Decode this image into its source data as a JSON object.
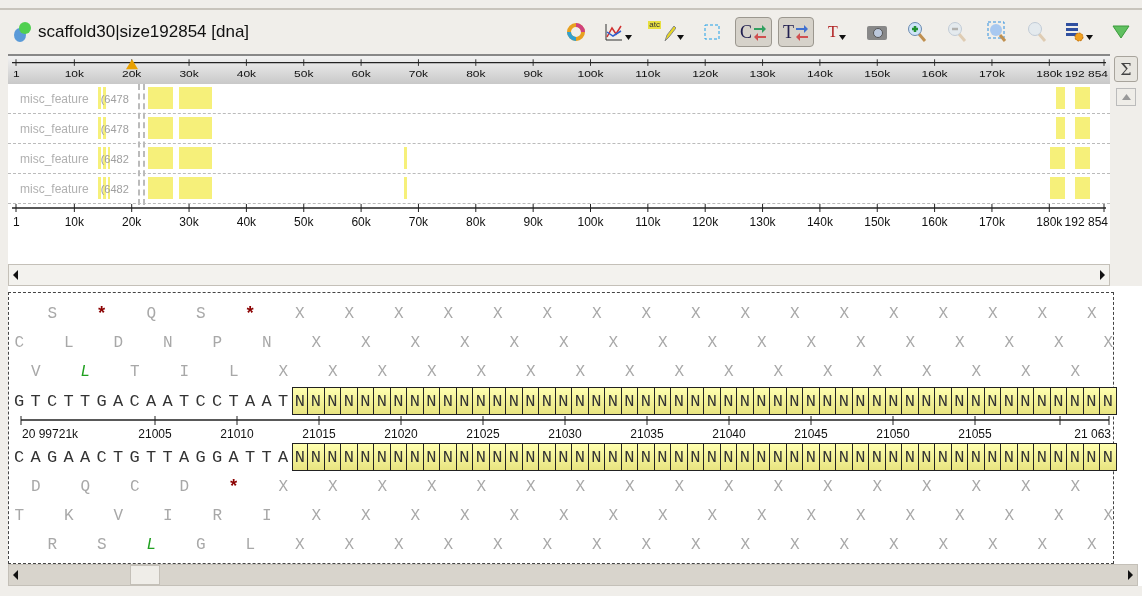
{
  "window": {
    "title": "scaffold30|size192854 [dna]"
  },
  "toolbar": [
    {
      "kind": "ring",
      "pressed": false,
      "disabled": false,
      "dropdown": false
    },
    {
      "kind": "graph",
      "pressed": false,
      "disabled": false,
      "dropdown": true
    },
    {
      "kind": "highlight",
      "glyph": "atc",
      "pressed": false,
      "disabled": false,
      "dropdown": true
    },
    {
      "kind": "select",
      "pressed": false,
      "disabled": false,
      "dropdown": false
    },
    {
      "kind": "complement",
      "glyph": "C",
      "pressed": true,
      "disabled": false,
      "dropdown": false
    },
    {
      "kind": "translate",
      "glyph": "T",
      "pressed": true,
      "disabled": false,
      "dropdown": false
    },
    {
      "kind": "font",
      "glyph": "T",
      "pressed": false,
      "disabled": false,
      "dropdown": true
    },
    {
      "kind": "camera",
      "pressed": false,
      "disabled": false,
      "dropdown": false
    },
    {
      "kind": "zoomin",
      "pressed": false,
      "disabled": false,
      "dropdown": false
    },
    {
      "kind": "zoomout",
      "pressed": false,
      "disabled": true,
      "dropdown": false
    },
    {
      "kind": "zoomselection",
      "pressed": false,
      "disabled": false,
      "dropdown": false
    },
    {
      "kind": "zoomall",
      "pressed": false,
      "disabled": true,
      "dropdown": false
    },
    {
      "kind": "settings",
      "pressed": false,
      "disabled": false,
      "dropdown": true
    },
    {
      "kind": "menu",
      "pressed": false,
      "disabled": false,
      "dropdown": false
    }
  ],
  "overview": {
    "ruler_labels": [
      "1",
      "10k",
      "20k",
      "30k",
      "40k",
      "50k",
      "60k",
      "70k",
      "80k",
      "90k",
      "100k",
      "110k",
      "120k",
      "130k",
      "140k",
      "150k",
      "160k",
      "170k",
      "180k",
      "192 854"
    ],
    "bottom_ruler_labels": [
      "1",
      "10k",
      "20k",
      "30k",
      "40k",
      "50k",
      "60k",
      "70k",
      "80k",
      "90k",
      "100k",
      "110k",
      "120k",
      "130k",
      "140k",
      "150k",
      "160k",
      "170k",
      "180k",
      "192 854"
    ],
    "tracks": [
      {
        "name": "misc_feature",
        "count": "(6478"
      },
      {
        "name": "misc_feature",
        "count": "(6478"
      },
      {
        "name": "misc_feature",
        "count": "(6482"
      },
      {
        "name": "misc_feature",
        "count": "(6482"
      }
    ],
    "sum_button": "Σ"
  },
  "detail": {
    "top_frames": [
      {
        "residues": [
          {
            "aa": "S",
            "kind": "plain"
          },
          {
            "aa": "*",
            "kind": "stop"
          },
          {
            "aa": "Q",
            "kind": "plain"
          },
          {
            "aa": "S",
            "kind": "plain"
          },
          {
            "aa": "*",
            "kind": "stop"
          },
          {
            "aa": "X",
            "kind": "plain"
          },
          {
            "aa": "X",
            "kind": "plain"
          },
          {
            "aa": "X",
            "kind": "plain"
          },
          {
            "aa": "X",
            "kind": "plain"
          },
          {
            "aa": "X",
            "kind": "plain"
          },
          {
            "aa": "X",
            "kind": "plain"
          },
          {
            "aa": "X",
            "kind": "plain"
          },
          {
            "aa": "X",
            "kind": "plain"
          },
          {
            "aa": "X",
            "kind": "plain"
          },
          {
            "aa": "X",
            "kind": "plain"
          },
          {
            "aa": "X",
            "kind": "plain"
          },
          {
            "aa": "X",
            "kind": "plain"
          },
          {
            "aa": "X",
            "kind": "plain"
          },
          {
            "aa": "X",
            "kind": "plain"
          },
          {
            "aa": "X",
            "kind": "plain"
          },
          {
            "aa": "X",
            "kind": "plain"
          },
          {
            "aa": "X",
            "kind": "plain"
          }
        ]
      },
      {
        "residues": [
          {
            "aa": "C",
            "kind": "plain"
          },
          {
            "aa": "L",
            "kind": "plain"
          },
          {
            "aa": "D",
            "kind": "plain"
          },
          {
            "aa": "N",
            "kind": "plain"
          },
          {
            "aa": "P",
            "kind": "plain"
          },
          {
            "aa": "N",
            "kind": "plain"
          },
          {
            "aa": "X",
            "kind": "plain"
          },
          {
            "aa": "X",
            "kind": "plain"
          },
          {
            "aa": "X",
            "kind": "plain"
          },
          {
            "aa": "X",
            "kind": "plain"
          },
          {
            "aa": "X",
            "kind": "plain"
          },
          {
            "aa": "X",
            "kind": "plain"
          },
          {
            "aa": "X",
            "kind": "plain"
          },
          {
            "aa": "X",
            "kind": "plain"
          },
          {
            "aa": "X",
            "kind": "plain"
          },
          {
            "aa": "X",
            "kind": "plain"
          },
          {
            "aa": "X",
            "kind": "plain"
          },
          {
            "aa": "X",
            "kind": "plain"
          },
          {
            "aa": "X",
            "kind": "plain"
          },
          {
            "aa": "X",
            "kind": "plain"
          },
          {
            "aa": "X",
            "kind": "plain"
          },
          {
            "aa": "X",
            "kind": "plain"
          },
          {
            "aa": "X",
            "kind": "plain"
          }
        ]
      },
      {
        "residues": [
          {
            "aa": "V",
            "kind": "plain"
          },
          {
            "aa": "L",
            "kind": "start"
          },
          {
            "aa": "T",
            "kind": "plain"
          },
          {
            "aa": "I",
            "kind": "plain"
          },
          {
            "aa": "L",
            "kind": "plain"
          },
          {
            "aa": "X",
            "kind": "plain"
          },
          {
            "aa": "X",
            "kind": "plain"
          },
          {
            "aa": "X",
            "kind": "plain"
          },
          {
            "aa": "X",
            "kind": "plain"
          },
          {
            "aa": "X",
            "kind": "plain"
          },
          {
            "aa": "X",
            "kind": "plain"
          },
          {
            "aa": "X",
            "kind": "plain"
          },
          {
            "aa": "X",
            "kind": "plain"
          },
          {
            "aa": "X",
            "kind": "plain"
          },
          {
            "aa": "X",
            "kind": "plain"
          },
          {
            "aa": "X",
            "kind": "plain"
          },
          {
            "aa": "X",
            "kind": "plain"
          },
          {
            "aa": "X",
            "kind": "plain"
          },
          {
            "aa": "X",
            "kind": "plain"
          },
          {
            "aa": "X",
            "kind": "plain"
          },
          {
            "aa": "X",
            "kind": "plain"
          },
          {
            "aa": "X",
            "kind": "plain"
          }
        ]
      }
    ],
    "top_strand": {
      "bases": "GTCTTGACAATCCTAAT",
      "masked": [
        "N",
        "N",
        "N",
        "N",
        "N",
        "N",
        "N",
        "N",
        "N",
        "N",
        "N",
        "N",
        "N",
        "N",
        "N",
        "N",
        "N",
        "N",
        "N",
        "N",
        "N",
        "N",
        "N",
        "N",
        "N",
        "N",
        "N",
        "N",
        "N",
        "N",
        "N",
        "N",
        "N",
        "N",
        "N",
        "N",
        "N",
        "N",
        "N",
        "N",
        "N",
        "N",
        "N",
        "N",
        "N",
        "N",
        "N",
        "N",
        "N",
        "N"
      ]
    },
    "ruler_labels": [
      "20 99721k",
      "21005",
      "21010",
      "21015",
      "21020",
      "21025",
      "21030",
      "21035",
      "21040",
      "21045",
      "21050",
      "21055",
      "21 063"
    ],
    "bottom_strand": {
      "bases": "CAGAACTGTTAGGATTA",
      "masked": [
        "N",
        "N",
        "N",
        "N",
        "N",
        "N",
        "N",
        "N",
        "N",
        "N",
        "N",
        "N",
        "N",
        "N",
        "N",
        "N",
        "N",
        "N",
        "N",
        "N",
        "N",
        "N",
        "N",
        "N",
        "N",
        "N",
        "N",
        "N",
        "N",
        "N",
        "N",
        "N",
        "N",
        "N",
        "N",
        "N",
        "N",
        "N",
        "N",
        "N",
        "N",
        "N",
        "N",
        "N",
        "N",
        "N",
        "N",
        "N",
        "N",
        "N"
      ]
    },
    "bottom_frames": [
      {
        "residues": [
          {
            "aa": "D",
            "kind": "plain"
          },
          {
            "aa": "Q",
            "kind": "plain"
          },
          {
            "aa": "C",
            "kind": "plain"
          },
          {
            "aa": "D",
            "kind": "plain"
          },
          {
            "aa": "*",
            "kind": "stop"
          },
          {
            "aa": "X",
            "kind": "plain"
          },
          {
            "aa": "X",
            "kind": "plain"
          },
          {
            "aa": "X",
            "kind": "plain"
          },
          {
            "aa": "X",
            "kind": "plain"
          },
          {
            "aa": "X",
            "kind": "plain"
          },
          {
            "aa": "X",
            "kind": "plain"
          },
          {
            "aa": "X",
            "kind": "plain"
          },
          {
            "aa": "X",
            "kind": "plain"
          },
          {
            "aa": "X",
            "kind": "plain"
          },
          {
            "aa": "X",
            "kind": "plain"
          },
          {
            "aa": "X",
            "kind": "plain"
          },
          {
            "aa": "X",
            "kind": "plain"
          },
          {
            "aa": "X",
            "kind": "plain"
          },
          {
            "aa": "X",
            "kind": "plain"
          },
          {
            "aa": "X",
            "kind": "plain"
          },
          {
            "aa": "X",
            "kind": "plain"
          },
          {
            "aa": "X",
            "kind": "plain"
          }
        ]
      },
      {
        "residues": [
          {
            "aa": "T",
            "kind": "plain"
          },
          {
            "aa": "K",
            "kind": "plain"
          },
          {
            "aa": "V",
            "kind": "plain"
          },
          {
            "aa": "I",
            "kind": "plain"
          },
          {
            "aa": "R",
            "kind": "plain"
          },
          {
            "aa": "I",
            "kind": "plain"
          },
          {
            "aa": "X",
            "kind": "plain"
          },
          {
            "aa": "X",
            "kind": "plain"
          },
          {
            "aa": "X",
            "kind": "plain"
          },
          {
            "aa": "X",
            "kind": "plain"
          },
          {
            "aa": "X",
            "kind": "plain"
          },
          {
            "aa": "X",
            "kind": "plain"
          },
          {
            "aa": "X",
            "kind": "plain"
          },
          {
            "aa": "X",
            "kind": "plain"
          },
          {
            "aa": "X",
            "kind": "plain"
          },
          {
            "aa": "X",
            "kind": "plain"
          },
          {
            "aa": "X",
            "kind": "plain"
          },
          {
            "aa": "X",
            "kind": "plain"
          },
          {
            "aa": "X",
            "kind": "plain"
          },
          {
            "aa": "X",
            "kind": "plain"
          },
          {
            "aa": "X",
            "kind": "plain"
          },
          {
            "aa": "X",
            "kind": "plain"
          },
          {
            "aa": "X",
            "kind": "plain"
          }
        ]
      },
      {
        "residues": [
          {
            "aa": "R",
            "kind": "plain"
          },
          {
            "aa": "S",
            "kind": "plain"
          },
          {
            "aa": "L",
            "kind": "start"
          },
          {
            "aa": "G",
            "kind": "plain"
          },
          {
            "aa": "L",
            "kind": "plain"
          },
          {
            "aa": "X",
            "kind": "plain"
          },
          {
            "aa": "X",
            "kind": "plain"
          },
          {
            "aa": "X",
            "kind": "plain"
          },
          {
            "aa": "X",
            "kind": "plain"
          },
          {
            "aa": "X",
            "kind": "plain"
          },
          {
            "aa": "X",
            "kind": "plain"
          },
          {
            "aa": "X",
            "kind": "plain"
          },
          {
            "aa": "X",
            "kind": "plain"
          },
          {
            "aa": "X",
            "kind": "plain"
          },
          {
            "aa": "X",
            "kind": "plain"
          },
          {
            "aa": "X",
            "kind": "plain"
          },
          {
            "aa": "X",
            "kind": "plain"
          },
          {
            "aa": "X",
            "kind": "plain"
          },
          {
            "aa": "X",
            "kind": "plain"
          },
          {
            "aa": "X",
            "kind": "plain"
          },
          {
            "aa": "X",
            "kind": "plain"
          },
          {
            "aa": "X",
            "kind": "plain"
          }
        ]
      }
    ]
  }
}
